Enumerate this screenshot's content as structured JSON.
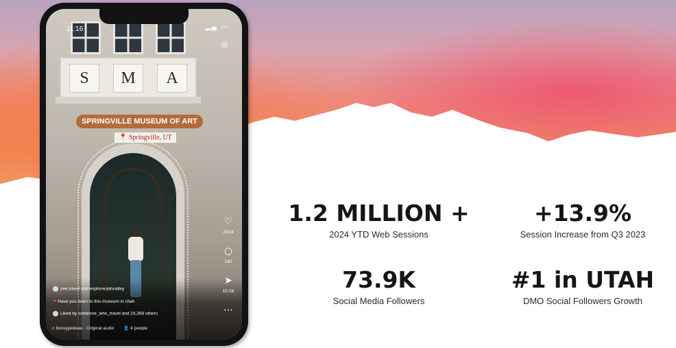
{
  "phone": {
    "status_time": "11:16",
    "sign_letters": [
      "S",
      "M",
      "A"
    ],
    "museum_tag": "SPRINGVILLE MUSEUM OF ART",
    "location_tag": "Springville, UT",
    "caption_user": "zee.travel and exploreutahvalley",
    "caption_comment": "Have you been to this museum in Utah",
    "caption_liked": "Liked by someone_who_travel and 24,368 others",
    "audio_label": "bossypedeau · Original audio",
    "people_label": "4 people",
    "side_counts": [
      "2024",
      "180",
      "10.5K"
    ]
  },
  "stats": [
    {
      "value": "1.2 MILLION +",
      "label": "2024 YTD Web Sessions"
    },
    {
      "value": "+13.9%",
      "label": "Session Increase from Q3 2023"
    },
    {
      "value": "73.9K",
      "label": "Social Media Followers"
    },
    {
      "value": "#1 in UTAH",
      "label": "DMO Social Followers Growth"
    }
  ],
  "icons": {
    "like": "heart-icon",
    "comment": "comment-icon",
    "share": "share-icon",
    "camera": "camera-icon",
    "pin": "location-pin-icon"
  },
  "colors": {
    "sky_top": "#c9a6b7",
    "sky_mid": "#f08a6a",
    "sky_pink": "#f0607a",
    "museum_tag": "#b56a3a",
    "text": "#151515"
  }
}
